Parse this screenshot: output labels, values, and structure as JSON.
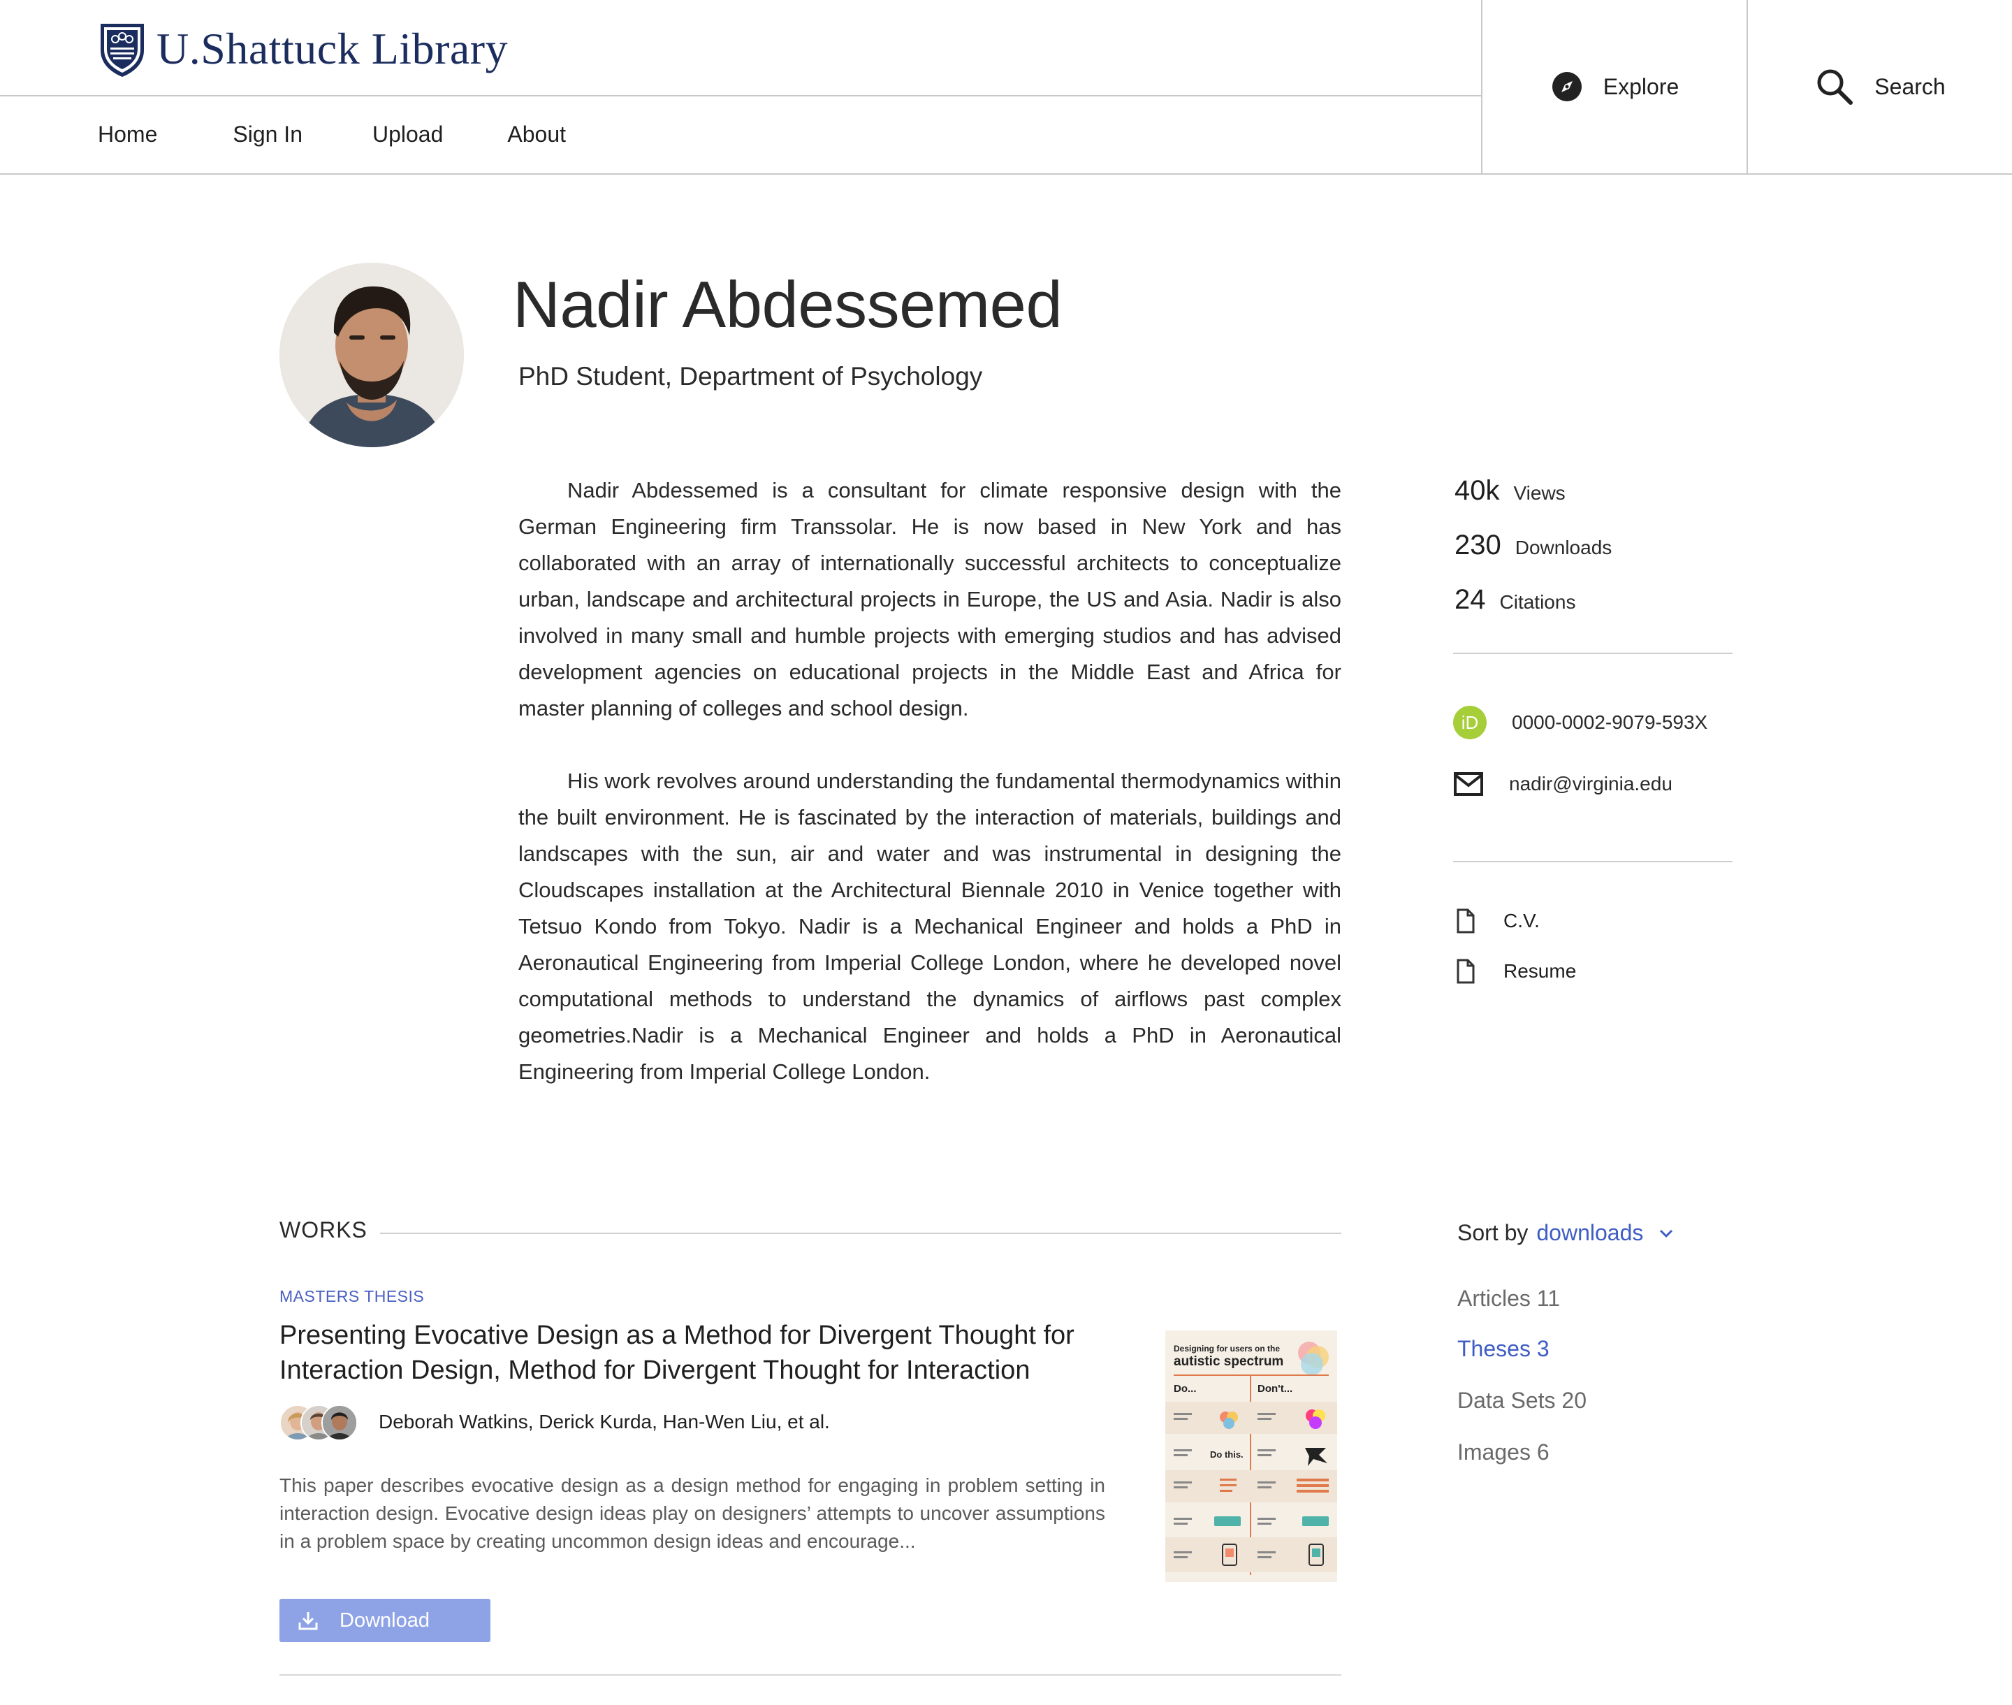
{
  "header": {
    "logo_text": "U.Shattuck Library",
    "nav": [
      "Home",
      "Sign In",
      "Upload",
      "About"
    ],
    "explore_label": "Explore",
    "search_label": "Search"
  },
  "profile": {
    "name": "Nadir Abdessemed",
    "subtitle": "PhD Student, Department of Psychology",
    "bio": [
      "Nadir Abdessemed is a consultant for climate responsive design with the German Engineering firm Transsolar. He is now based in New York and has collaborated with an array of internationally successful architects to conceptualize urban, landscape and architectural projects in Europe, the US and Asia. Nadir is also involved in many small and humble projects with emerging studios and has advised development agencies on educational projects in the Middle East and Africa for master planning of colleges and school design.",
      "His work revolves around understanding the fundamental thermodynamics within the built environment. He is fascinated by the interaction of materials, buildings and landscapes with the sun, air and water and was instrumental in designing the Cloudscapes installation at the Architectural Biennale 2010 in Venice together with Tetsuo Kondo from Tokyo. Nadir is a Mechanical Engineer and holds a PhD in Aeronautical Engineering from Imperial College London, where he developed novel computational methods to understand the dynamics of airflows past complex geometries.Nadir is a Mechanical Engineer and holds a PhD in Aeronautical Engineering from Imperial College London."
    ]
  },
  "stats": [
    {
      "value": "40k",
      "label": "Views"
    },
    {
      "value": "230",
      "label": "Downloads"
    },
    {
      "value": "24",
      "label": "Citations"
    }
  ],
  "contact": {
    "orcid_badge": "iD",
    "orcid": "0000-0002-9079-593X",
    "email": "nadir@virginia.edu"
  },
  "files": [
    "C.V.",
    "Resume"
  ],
  "works": {
    "heading": "WORKS",
    "item": {
      "type": "MASTERS THESIS",
      "title": "Presenting Evocative Design as a Method for Divergent Thought for Interaction Design, Method for Divergent Thought for Interaction",
      "authors": "Deborah Watkins, Derick Kurda, Han-Wen Liu, et al.",
      "abstract": "This paper describes evocative design as a design method for engaging in problem setting in interaction design. Evocative design ideas play on designers’ attempts to uncover assumptions in a problem space by creating uncommon design ideas and encourage...",
      "download_label": "Download",
      "thumbnail": {
        "title_small": "Designing for users on the",
        "title_big": "autistic spectrum",
        "do": "Do...",
        "dont": "Don't...",
        "do_this": "Do this."
      }
    }
  },
  "sort": {
    "label": "Sort by",
    "value": "downloads"
  },
  "filters": [
    {
      "label": "Articles 11",
      "active": false
    },
    {
      "label": "Theses 3",
      "active": true
    },
    {
      "label": "Data Sets 20",
      "active": false
    },
    {
      "label": "Images 6",
      "active": false
    }
  ],
  "colors": {
    "brand_navy": "#1b2d5e",
    "accent_blue": "#3f5dc4",
    "download_button": "#8ea2e6",
    "orcid_green": "#a6ce39"
  }
}
